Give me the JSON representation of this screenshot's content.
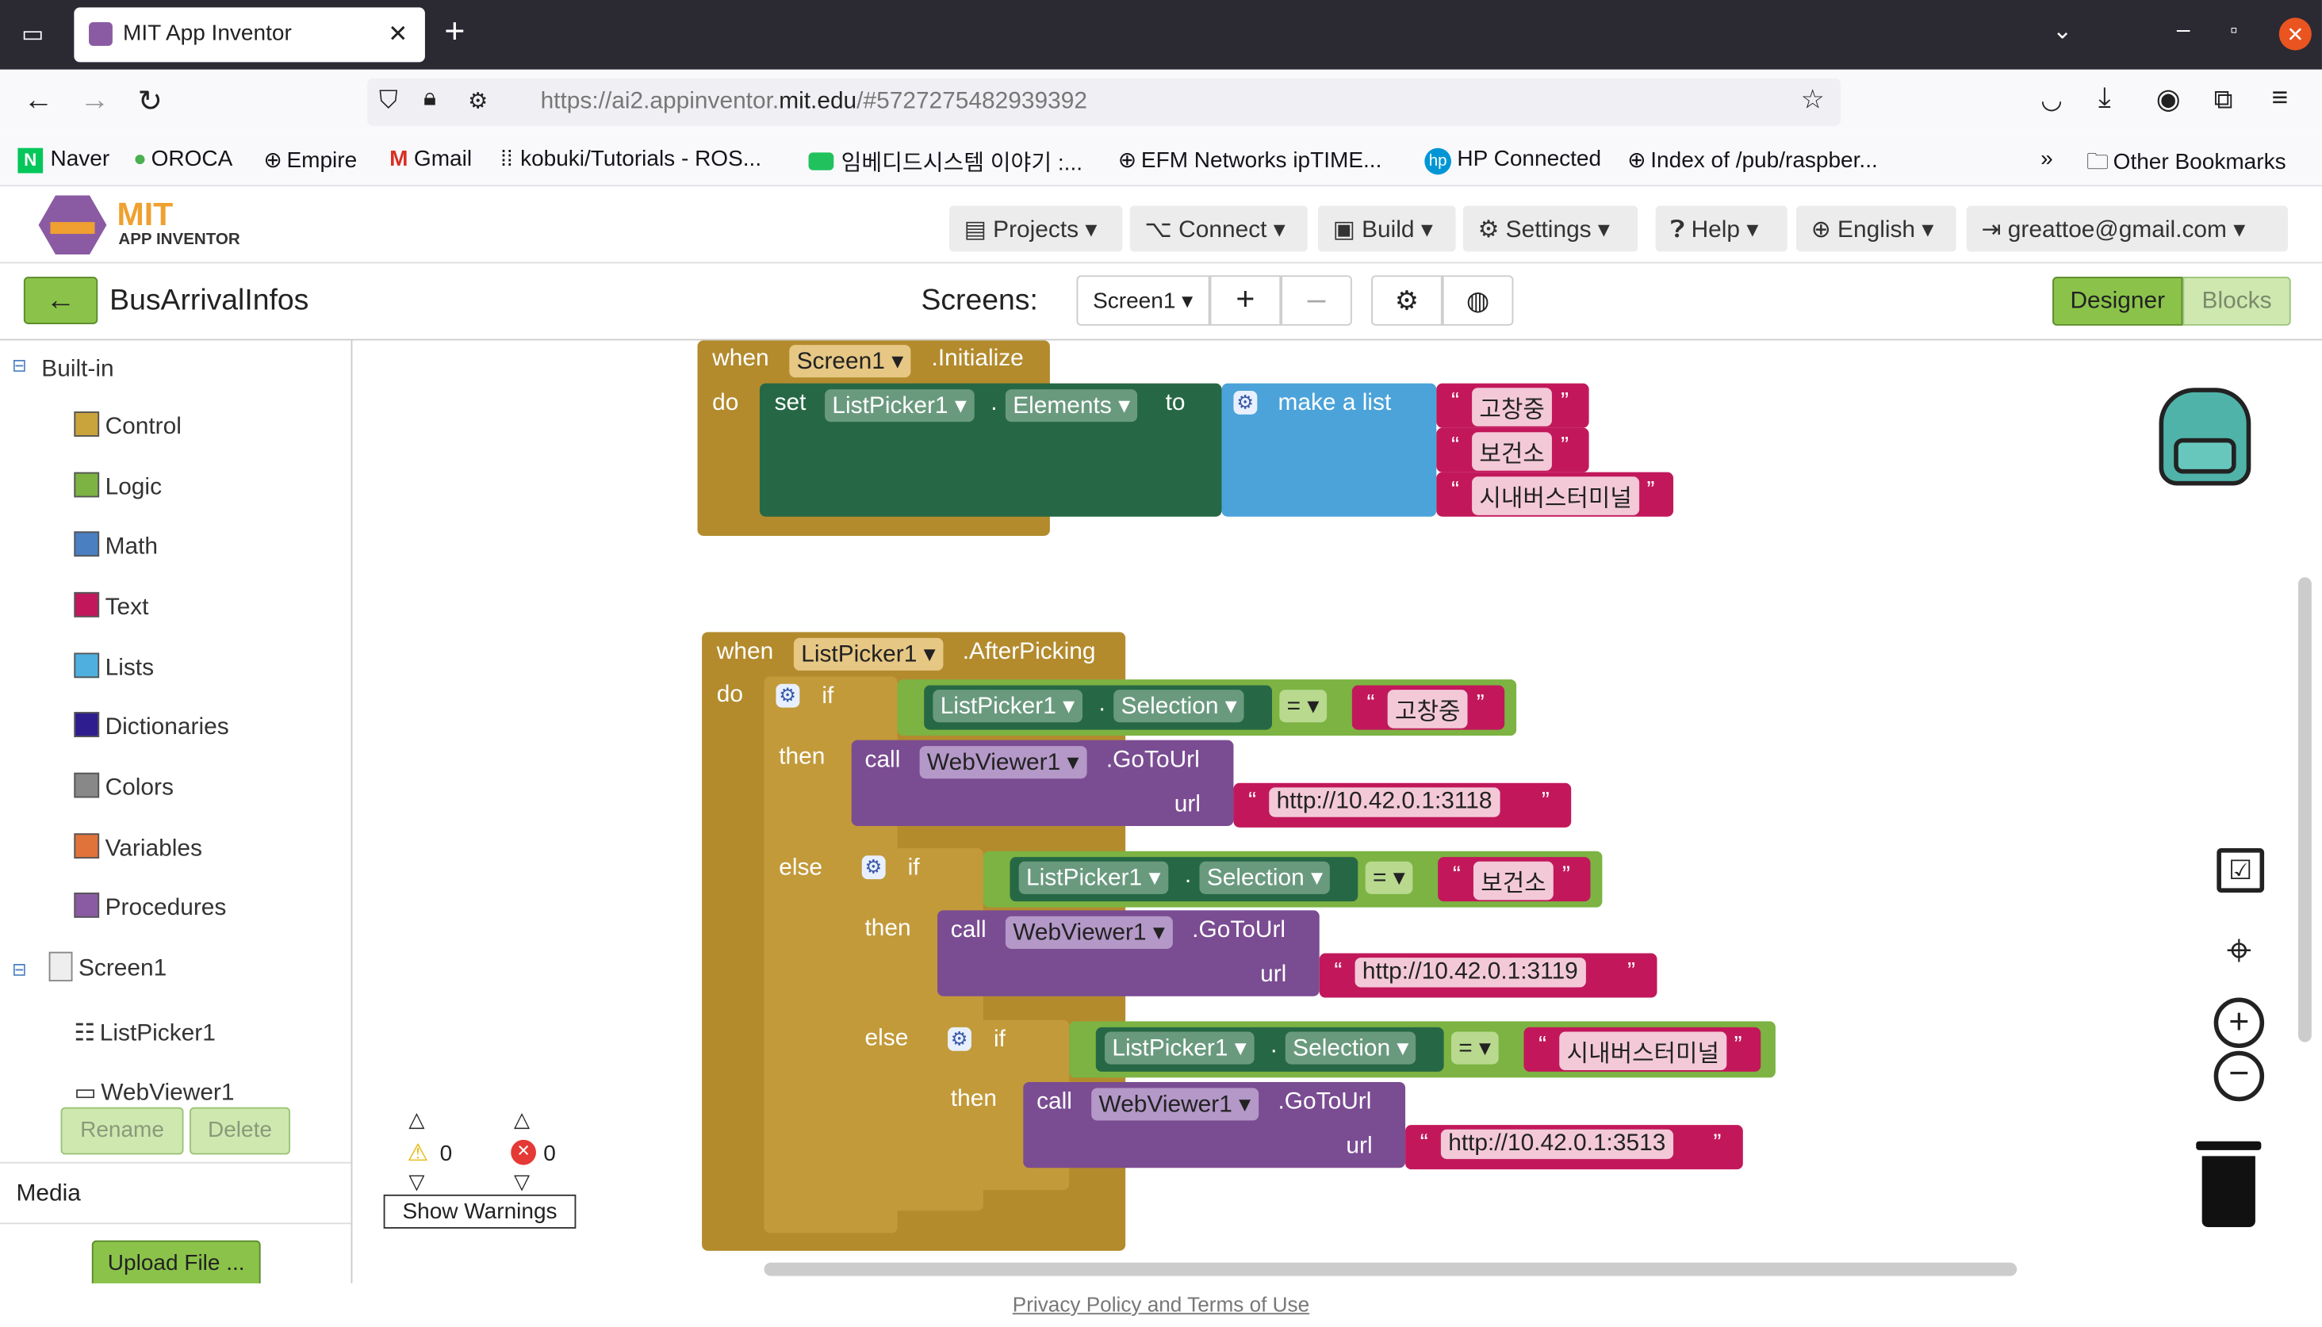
{
  "browser": {
    "tab_title": "MIT App Inventor",
    "url_prefix": "https://ai2.appinventor.",
    "url_domain": "mit.edu",
    "url_suffix": "/#5727275482939392",
    "bookmarks": [
      "Naver",
      "OROCA",
      "Empire",
      "Gmail",
      "kobuki/Tutorials - ROS...",
      "임베디드시스템 이야기 :...",
      "EFM Networks ipTIME...",
      "HP Connected",
      "Index of /pub/raspber..."
    ],
    "other_bookmarks": "Other Bookmarks"
  },
  "app": {
    "logo_text": "MIT",
    "logo_sub": "APP INVENTOR",
    "menus": [
      "Projects ▾",
      "Connect ▾",
      "Build ▾",
      "Settings ▾",
      "Help ▾",
      "English ▾",
      "greattoe@gmail.com ▾"
    ]
  },
  "toolbar": {
    "project_name": "BusArrivalInfos",
    "screens_label": "Screens:",
    "screen_select": "Screen1 ▾",
    "designer": "Designer",
    "blocks": "Blocks"
  },
  "sidebar": {
    "builtin": "Built-in",
    "categories": [
      {
        "label": "Control",
        "color": "#c9a33c"
      },
      {
        "label": "Logic",
        "color": "#7cb342"
      },
      {
        "label": "Math",
        "color": "#4a7fc1"
      },
      {
        "label": "Text",
        "color": "#c2185b"
      },
      {
        "label": "Lists",
        "color": "#4fb0e0"
      },
      {
        "label": "Dictionaries",
        "color": "#2d1d8e"
      },
      {
        "label": "Colors",
        "color": "#888888"
      },
      {
        "label": "Variables",
        "color": "#e0733a"
      },
      {
        "label": "Procedures",
        "color": "#8a5ba3"
      }
    ],
    "screen": "Screen1",
    "components": [
      "ListPicker1",
      "WebViewer1"
    ],
    "rename": "Rename",
    "delete": "Delete",
    "media": "Media",
    "upload": "Upload File ..."
  },
  "blocks": {
    "when": "when",
    "do": "do",
    "set": "set",
    "to": "to",
    "dot": ".",
    "screen1": "Screen1",
    "initialize": ".Initialize",
    "listpicker": "ListPicker1",
    "elements": "Elements",
    "make_list": "make a list",
    "afterpicking": ".AfterPicking",
    "if": "if",
    "then": "then",
    "else": "else",
    "selection": "Selection",
    "eq": "=",
    "call": "call",
    "webviewer": "WebViewer1",
    "gotourl": ".GoToUrl",
    "url": "url",
    "q_open": "“",
    "q_close": "”",
    "items": [
      "고창중",
      "보건소",
      "시내버스터미널"
    ],
    "urls": [
      "http://10.42.0.1:3118",
      "http://10.42.0.1:3119",
      "http://10.42.0.1:3513"
    ]
  },
  "warnings": {
    "warn_count": "0",
    "error_count": "0",
    "button": "Show Warnings"
  },
  "footer": "Privacy Policy and Terms of Use"
}
